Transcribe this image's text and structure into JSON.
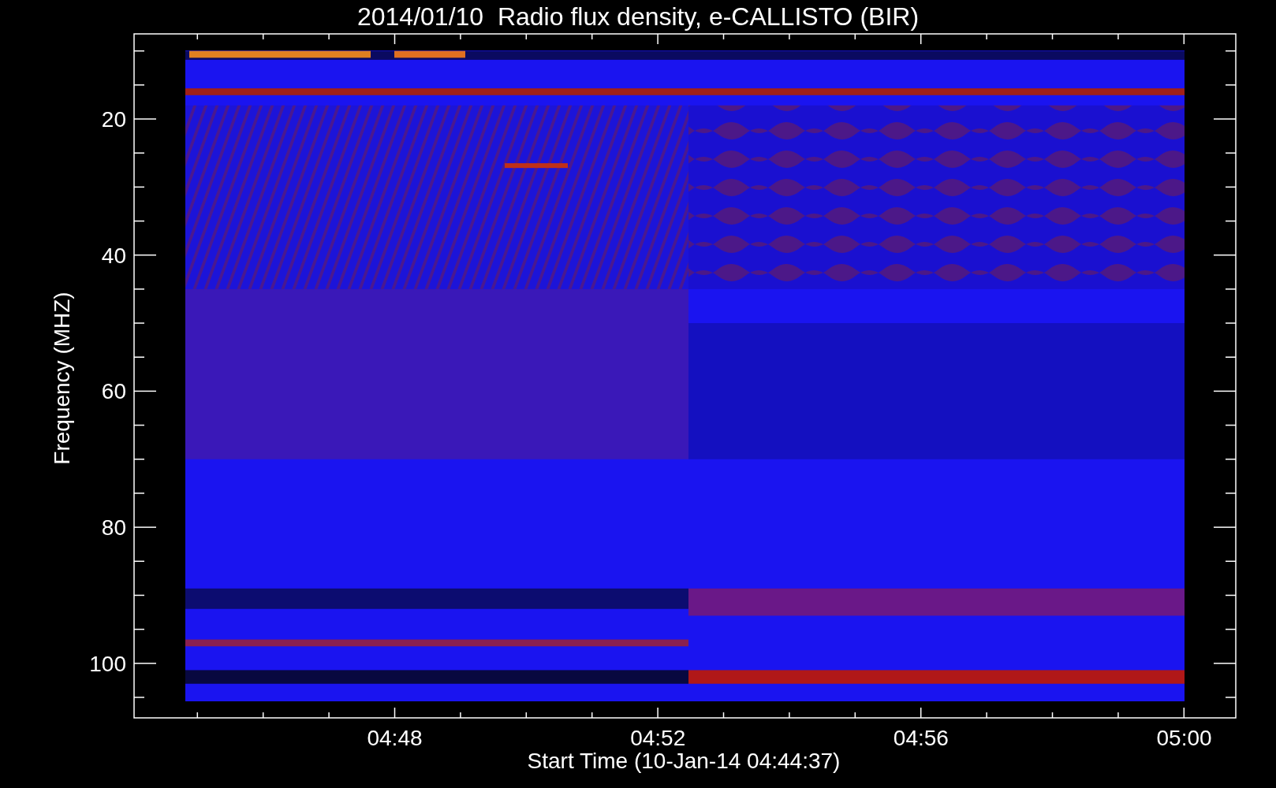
{
  "title": "2014/01/10  Radio flux density, e-CALLISTO (BIR)",
  "y_axis": {
    "label": "Frequency (MHZ)",
    "ticks": [
      "20",
      "40",
      "60",
      "80",
      "100"
    ]
  },
  "x_axis": {
    "label": "Start Time (10-Jan-14 04:44:37)",
    "ticks": [
      "04:48",
      "04:52",
      "04:56",
      "05:00"
    ]
  }
}
